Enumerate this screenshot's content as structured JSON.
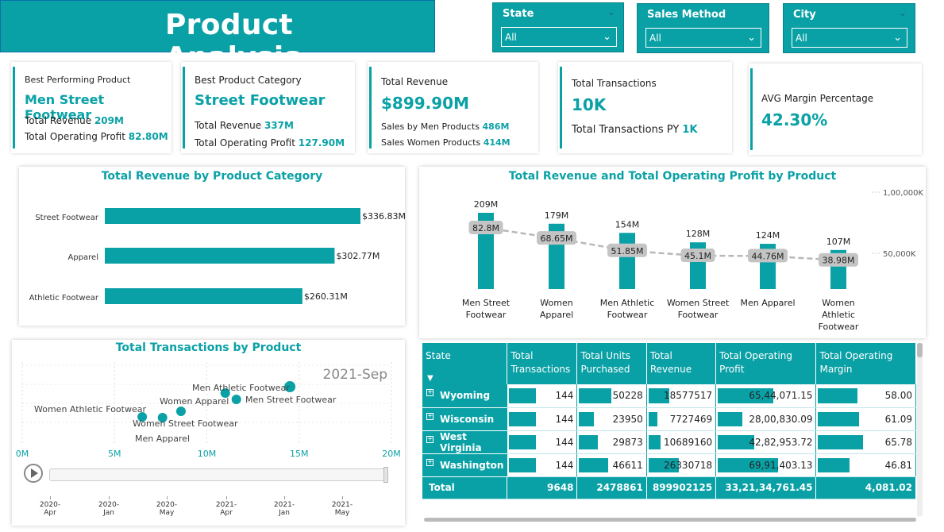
{
  "title": "Product Analysis",
  "slicers": [
    {
      "label": "State",
      "value": "All"
    },
    {
      "label": "Sales Method",
      "value": "All"
    },
    {
      "label": "City",
      "value": "All"
    }
  ],
  "kpi": {
    "best_product": {
      "label": "Best Performing Product",
      "value": "Men Street Footwear",
      "rev_label": "Total Revenue",
      "rev_value": "209M",
      "profit_label": "Total Operating Profit",
      "profit_value": "82.80M"
    },
    "best_category": {
      "label": "Best Product Category",
      "value": "Street Footwear",
      "rev_label": "Total Revenue",
      "rev_value": "337M",
      "profit_label": "Total Operating Profit",
      "profit_value": "127.90M"
    },
    "revenue": {
      "label": "Total Revenue",
      "value": "$899.90M",
      "men_label": "Sales by Men Products",
      "men_value": "486M",
      "women_label": "Sales Women Products",
      "women_value": "414M"
    },
    "transactions": {
      "label": "Total Transactions",
      "value": "10K",
      "py_label": "Total Transactions PY",
      "py_value": "1K"
    },
    "margin": {
      "label": "AVG Margin Percentage",
      "value": "42.30%"
    }
  },
  "chart_data": [
    {
      "type": "bar",
      "title": "Total Revenue by Product Category",
      "categories": [
        "Street Footwear",
        "Apparel",
        "Athletic Footwear"
      ],
      "values": [
        336.83,
        302.77,
        260.31
      ],
      "data_labels": [
        "$336.83M",
        "$302.77M",
        "$260.31M"
      ],
      "orientation": "horizontal"
    },
    {
      "type": "bar",
      "title": "Total Revenue and Total Operating Profit by Product",
      "categories": [
        "Men Street Footwear",
        "Women Apparel",
        "Men Athletic Footwear",
        "Women Street Footwear",
        "Men Apparel",
        "Women Athletic Footwear"
      ],
      "category_lines": [
        [
          "Men Street",
          "Footwear"
        ],
        [
          "Women",
          "Apparel"
        ],
        [
          "Men Athletic",
          "Footwear"
        ],
        [
          "Women Street",
          "Footwear"
        ],
        [
          "Men Apparel"
        ],
        [
          "Women",
          "Athletic",
          "Footwear"
        ]
      ],
      "series": [
        {
          "values": [
            209,
            179,
            154,
            128,
            124,
            107
          ],
          "labels": [
            "209M",
            "179M",
            "154M",
            "128M",
            "124M",
            "107M"
          ],
          "kind": "bar"
        },
        {
          "values": [
            82.8,
            68.65,
            51.85,
            45.1,
            44.76,
            38.98
          ],
          "labels": [
            "82.8M",
            "68.65M",
            "51.85M",
            "45.1M",
            "44.76M",
            "38.98M"
          ],
          "kind": "line"
        }
      ],
      "secondary_ticks": [
        "1,00,000K",
        "50,000K"
      ],
      "secondary_tick_values": [
        100,
        50
      ]
    },
    {
      "type": "scatter",
      "title": "Total Transactions by Product",
      "x_ticks": [
        "0M",
        "5M",
        "10M",
        "15M",
        "20M"
      ],
      "x_tick_values": [
        0,
        5,
        10,
        15,
        20
      ],
      "points": [
        {
          "label": "Women Athletic Footwear",
          "x": 6.5
        },
        {
          "label": "Women Street Footwear",
          "x": 7.6
        },
        {
          "label": "Men Apparel",
          "x": 8.6
        },
        {
          "label": "Women Apparel",
          "x": 11.0
        },
        {
          "label": "Men Street Footwear",
          "x": 11.6
        },
        {
          "label": "Men Athletic Footwear",
          "x": 14.5
        }
      ],
      "play_label": "2021-Sep",
      "timeline": [
        "2020-Apr",
        "2020-Jan",
        "2020-May",
        "2021-Apr",
        "2021-Jan",
        "2021-May"
      ]
    }
  ],
  "table": {
    "columns": [
      "State",
      "Total Transactions",
      "Total Units Purchased",
      "Total Revenue",
      "Total Operating Profit",
      "Total Operating Margin"
    ],
    "rows": [
      {
        "state": "Wyoming",
        "tx": "144",
        "units": "50228",
        "rev": "18577517",
        "profit": "65,44,071.15",
        "margin": "58.00",
        "b": [
          0.38,
          0.45,
          0.3,
          0.55,
          0.36
        ]
      },
      {
        "state": "Wisconsin",
        "tx": "144",
        "units": "23950",
        "rev": "7727469",
        "profit": "28,00,830.09",
        "margin": "61.09",
        "b": [
          0.38,
          0.21,
          0.12,
          0.24,
          0.38
        ]
      },
      {
        "state": "West Virginia",
        "tx": "144",
        "units": "29873",
        "rev": "10689160",
        "profit": "42,82,953.72",
        "margin": "65.78",
        "b": [
          0.38,
          0.26,
          0.17,
          0.36,
          0.41
        ]
      },
      {
        "state": "Washington",
        "tx": "144",
        "units": "46611",
        "rev": "26330718",
        "profit": "69,91,403.13",
        "margin": "46.81",
        "b": [
          0.38,
          0.41,
          0.43,
          0.59,
          0.29
        ]
      }
    ],
    "total": {
      "label": "Total",
      "tx": "9648",
      "units": "2478861",
      "rev": "899902125",
      "profit": "33,21,34,761.45",
      "margin": "4,081.02"
    }
  },
  "colors": {
    "accent": "#0aa1a6",
    "label_bg": "#c4c4c4",
    "line": "#b8b8b8"
  }
}
